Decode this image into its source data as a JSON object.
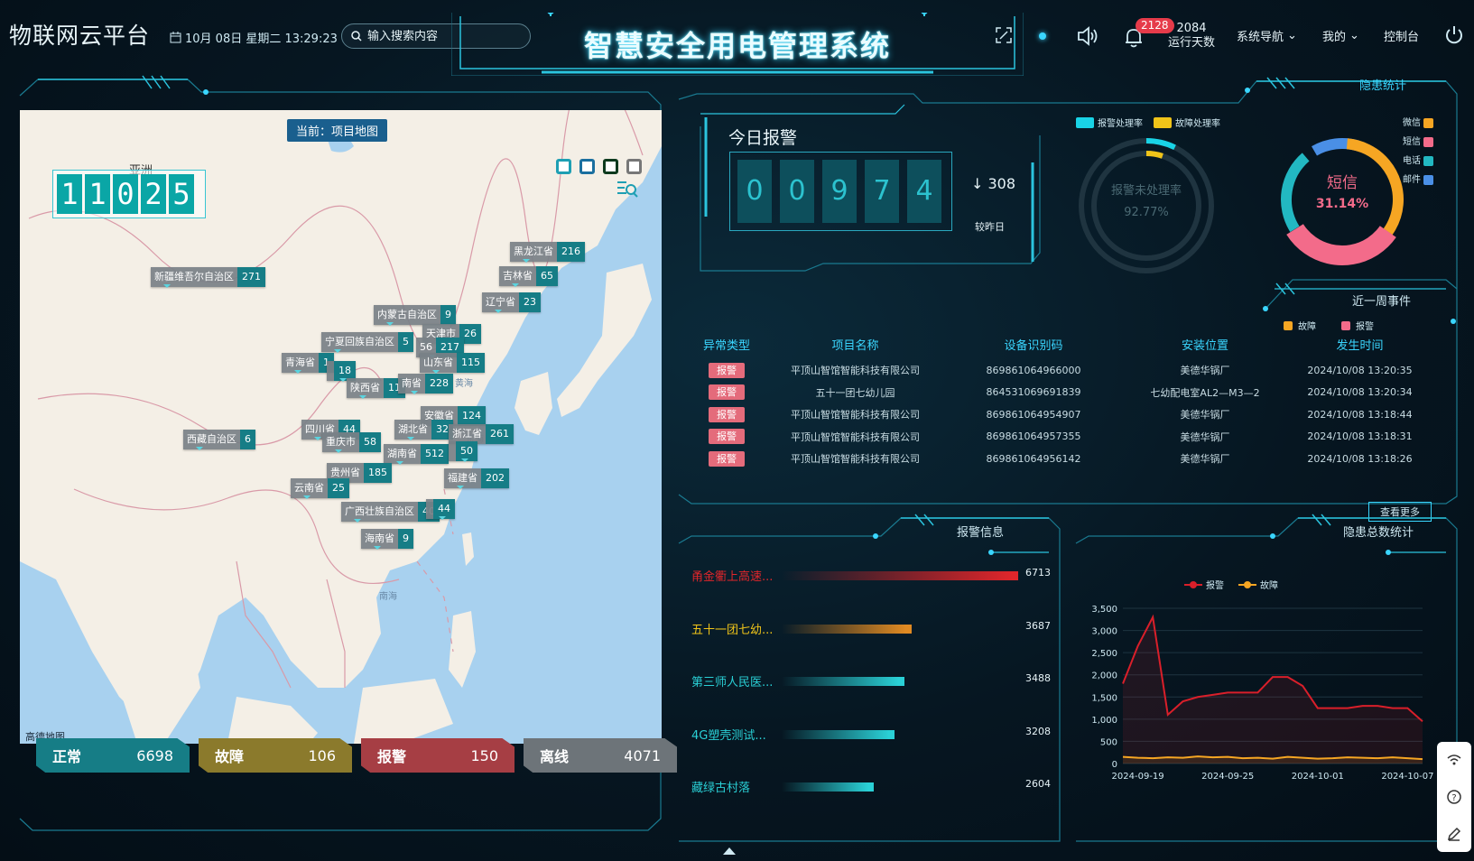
{
  "header": {
    "brand": "物联网云平台",
    "datetime": "10月 08日 星期二 13:29:23",
    "search_placeholder": "输入搜索内容",
    "title": "智慧安全用电管理系统",
    "notification_count": "2128",
    "run_days_value": "2084",
    "run_days_label": "运行天数",
    "nav_menu": "系统导航",
    "my_menu": "我的",
    "console": "控制台"
  },
  "map": {
    "tag": "当前：项目地图",
    "counter_digits": [
      "1",
      "1",
      "0",
      "2",
      "5"
    ],
    "label_region": "亚洲",
    "label_yellow_sea": "黄海",
    "label_east_sea": "东海",
    "label_south_sea": "南海",
    "logo": "高德地图",
    "pins": [
      {
        "name": "黑龙江省",
        "value": "216"
      },
      {
        "name": "吉林省",
        "value": "65"
      },
      {
        "name": "辽宁省",
        "value": "23"
      },
      {
        "name": "新疆维吾尔自治区",
        "value": "271"
      },
      {
        "name": "内蒙古自治区",
        "value": "9"
      },
      {
        "name": "天津市",
        "value": "26"
      },
      {
        "name": "宁夏回族自治区",
        "value": "5"
      },
      {
        "name": "56",
        "value": "217"
      },
      {
        "name": "青海省",
        "value": "1"
      },
      {
        "name": "",
        "value": "18"
      },
      {
        "name": "山东省",
        "value": "115"
      },
      {
        "name": "陕西省",
        "value": "11"
      },
      {
        "name": "南省",
        "value": "228"
      },
      {
        "name": "安徽省",
        "value": "124"
      },
      {
        "name": "四川省",
        "value": "44"
      },
      {
        "name": "湖北省",
        "value": "32"
      },
      {
        "name": "浙江省",
        "value": "261"
      },
      {
        "name": "西藏自治区",
        "value": "6"
      },
      {
        "name": "重庆市",
        "value": "58"
      },
      {
        "name": "湖南省",
        "value": "512"
      },
      {
        "name": "",
        "value": "50"
      },
      {
        "name": "贵州省",
        "value": "185"
      },
      {
        "name": "福建省",
        "value": "202"
      },
      {
        "name": "云南省",
        "value": "25"
      },
      {
        "name": "广西壮族自治区",
        "value": "40"
      },
      {
        "name": "",
        "value": "44"
      },
      {
        "name": "海南省",
        "value": "9"
      }
    ]
  },
  "stats": [
    {
      "label": "正常",
      "value": "6698",
      "color": "#167d86"
    },
    {
      "label": "故障",
      "value": "106",
      "color": "#8b7a2c"
    },
    {
      "label": "报警",
      "value": "150",
      "color": "#a63e44"
    },
    {
      "label": "离线",
      "value": "4071",
      "color": "#6d7479"
    }
  ],
  "today_alarm": {
    "title": "今日报警",
    "digits": [
      "0",
      "0",
      "9",
      "7",
      "4"
    ],
    "delta": "308",
    "delta_label": "较昨日",
    "legend_alarm": "报警处理率",
    "legend_fault": "故障处理率",
    "gauge_label": "报警未处理率",
    "gauge_value": "92.77%",
    "gauge_fraction": 0.0723
  },
  "hazard_stats": {
    "title": "隐患统计",
    "center_label": "短信",
    "center_value": "31.14%",
    "legend": [
      {
        "name": "微信",
        "color": "#f6a623"
      },
      {
        "name": "短信",
        "color": "#f36b8a"
      },
      {
        "name": "电话",
        "color": "#22b8c2"
      },
      {
        "name": "邮件",
        "color": "#4a8fe6"
      }
    ]
  },
  "week_events": {
    "title": "近一周事件",
    "legend_fault": "故障",
    "legend_alarm": "报警",
    "headers": [
      "异常类型",
      "项目名称",
      "设备识别码",
      "安装位置",
      "发生时间"
    ],
    "rows": [
      {
        "type": "报警",
        "project": "平顶山智馆智能科技有限公司",
        "code": "869861064966000",
        "location": "美德华锅厂",
        "time": "2024/10/08 13:20:35"
      },
      {
        "type": "报警",
        "project": "五十一团七幼儿园",
        "code": "864531069691839",
        "location": "七幼配电室AL2—M3—2",
        "time": "2024/10/08 13:20:34"
      },
      {
        "type": "报警",
        "project": "平顶山智馆智能科技有限公司",
        "code": "869861064954907",
        "location": "美德华锅厂",
        "time": "2024/10/08 13:18:44"
      },
      {
        "type": "报警",
        "project": "平顶山智馆智能科技有限公司",
        "code": "869861064957355",
        "location": "美德华锅厂",
        "time": "2024/10/08 13:18:31"
      },
      {
        "type": "报警",
        "project": "平顶山智馆智能科技有限公司",
        "code": "869861064956142",
        "location": "美德华锅厂",
        "time": "2024/10/08 13:18:26"
      }
    ],
    "more": "查看更多"
  },
  "alarm_info": {
    "title": "报警信息",
    "items": [
      {
        "name": "甬金衢上高速...",
        "value": "6713",
        "fraction": 1.0,
        "color": "#e0262b"
      },
      {
        "name": "五十一团七幼...",
        "value": "3687",
        "fraction": 0.549,
        "color": "#e08a22"
      },
      {
        "name": "第三师人民医...",
        "value": "3488",
        "fraction": 0.52,
        "color": "#2ad0d6"
      },
      {
        "name": "4G塑壳测试...",
        "value": "3208",
        "fraction": 0.478,
        "color": "#2ad0d6"
      },
      {
        "name": "藏绿古村落",
        "value": "2604",
        "fraction": 0.388,
        "color": "#2ad0d6"
      }
    ]
  },
  "hazard_total": {
    "title": "隐患总数统计"
  },
  "chart_data": {
    "type": "area",
    "legend": [
      "报警",
      "故障"
    ],
    "ylim": [
      0,
      3500
    ],
    "yticks": [
      "0",
      "500",
      "1,000",
      "1,500",
      "2,000",
      "2,500",
      "3,000",
      "3,500"
    ],
    "xtick_labels": [
      "2024-09-19",
      "2024-09-25",
      "2024-10-01",
      "2024-10-07"
    ],
    "x": [
      "2024-09-18",
      "2024-09-19",
      "2024-09-20",
      "2024-09-21",
      "2024-09-22",
      "2024-09-23",
      "2024-09-24",
      "2024-09-25",
      "2024-09-26",
      "2024-09-27",
      "2024-09-28",
      "2024-09-29",
      "2024-09-30",
      "2024-10-01",
      "2024-10-02",
      "2024-10-03",
      "2024-10-04",
      "2024-10-05",
      "2024-10-06",
      "2024-10-07",
      "2024-10-08"
    ],
    "series": [
      {
        "name": "报警",
        "color": "#d91f2a",
        "values": [
          1800,
          2650,
          3300,
          1100,
          1400,
          1500,
          1550,
          1600,
          1600,
          1600,
          1950,
          1950,
          1750,
          1250,
          1250,
          1250,
          1300,
          1300,
          1250,
          1250,
          950
        ]
      },
      {
        "name": "故障",
        "color": "#f6a623",
        "values": [
          150,
          130,
          120,
          140,
          130,
          160,
          140,
          150,
          120,
          130,
          110,
          150,
          130,
          110,
          120,
          140,
          130,
          120,
          140,
          120,
          100
        ]
      }
    ]
  }
}
